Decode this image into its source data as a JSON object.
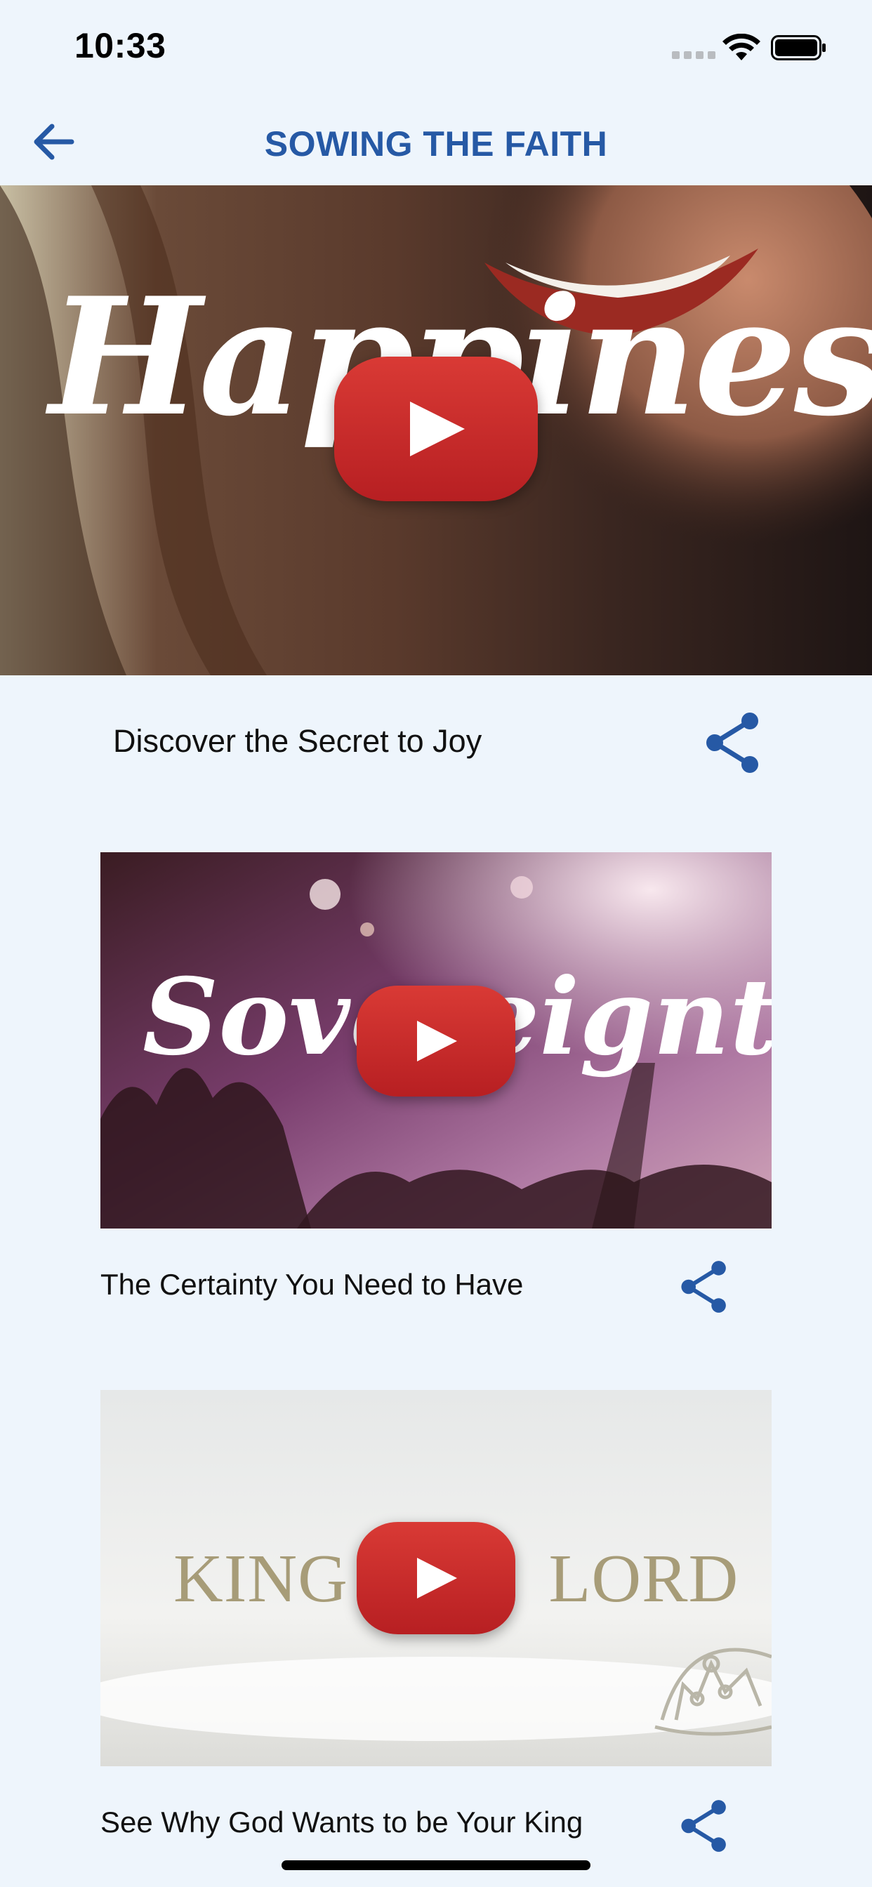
{
  "status_bar": {
    "time": "10:33"
  },
  "header": {
    "title": "SOWING THE FAITH",
    "back_icon": "arrow-left-icon"
  },
  "videos": [
    {
      "overlay_text": "Happiness",
      "title": "Discover the Secret to Joy",
      "play_icon": "youtube-play-icon",
      "share_icon": "share-icon"
    },
    {
      "overlay_text": "Sovereignty",
      "title": "The Certainty You Need to Have",
      "play_icon": "youtube-play-icon",
      "share_icon": "share-icon"
    },
    {
      "overlay_text": "KING LORD",
      "title": "See Why God Wants to be Your King",
      "play_icon": "youtube-play-icon",
      "share_icon": "share-icon"
    }
  ],
  "colors": {
    "accent": "#2659A5",
    "background": "#EEF5FC",
    "youtube_red": "#D0262A"
  }
}
